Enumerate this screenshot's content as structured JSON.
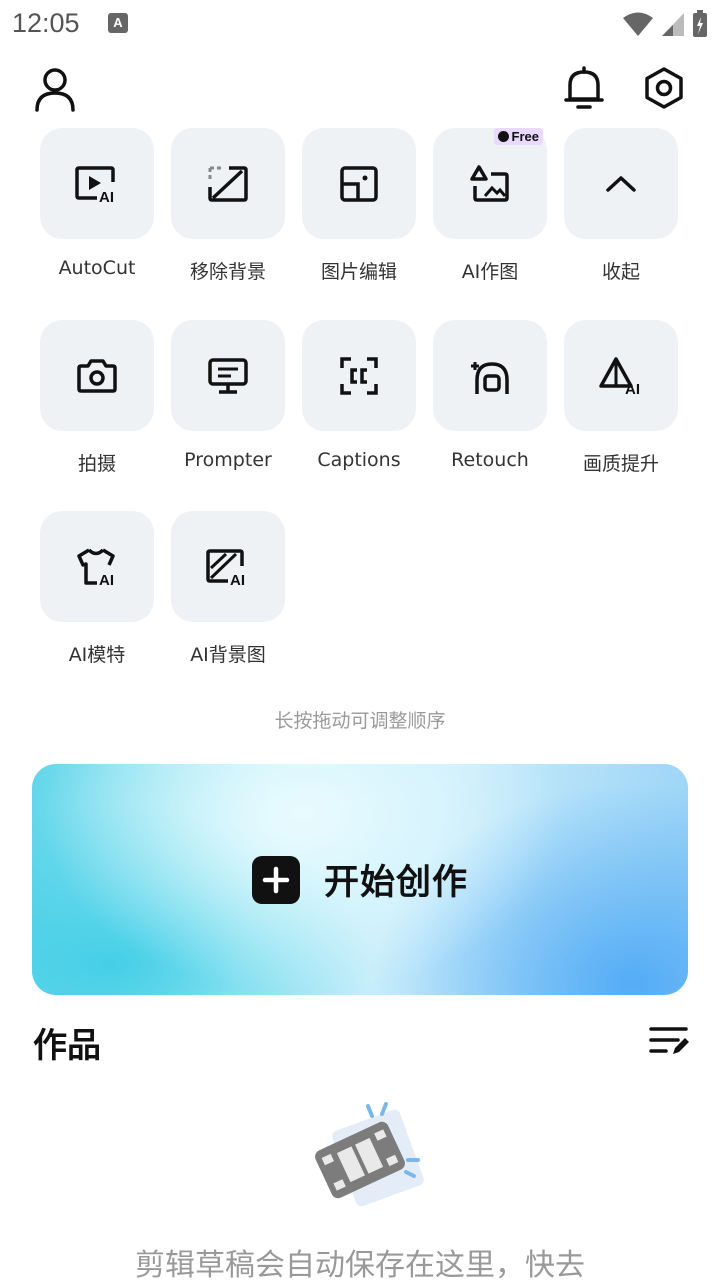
{
  "status_bar": {
    "time": "12:05",
    "notification_badge": "A"
  },
  "tools": [
    {
      "label": "AutoCut",
      "icon": "autocut-icon"
    },
    {
      "label": "移除背景",
      "icon": "remove-background-icon"
    },
    {
      "label": "图片编辑",
      "icon": "image-edit-icon"
    },
    {
      "label": "AI作图",
      "icon": "ai-draw-icon",
      "badge": "Free"
    },
    {
      "label": "收起",
      "icon": "chevron-up-icon"
    },
    {
      "label": "拍摄",
      "icon": "camera-icon"
    },
    {
      "label": "Prompter",
      "icon": "prompter-icon"
    },
    {
      "label": "Captions",
      "icon": "captions-icon"
    },
    {
      "label": "Retouch",
      "icon": "retouch-icon"
    },
    {
      "label": "画质提升",
      "icon": "enhance-quality-icon"
    },
    {
      "label": "AI模特",
      "icon": "ai-model-icon"
    },
    {
      "label": "AI背景图",
      "icon": "ai-background-icon"
    }
  ],
  "hint": "长按拖动可调整顺序",
  "banner": {
    "label": "开始创作"
  },
  "works": {
    "title": "作品",
    "empty_text": "剪辑草稿会自动保存在这里，快去"
  }
}
